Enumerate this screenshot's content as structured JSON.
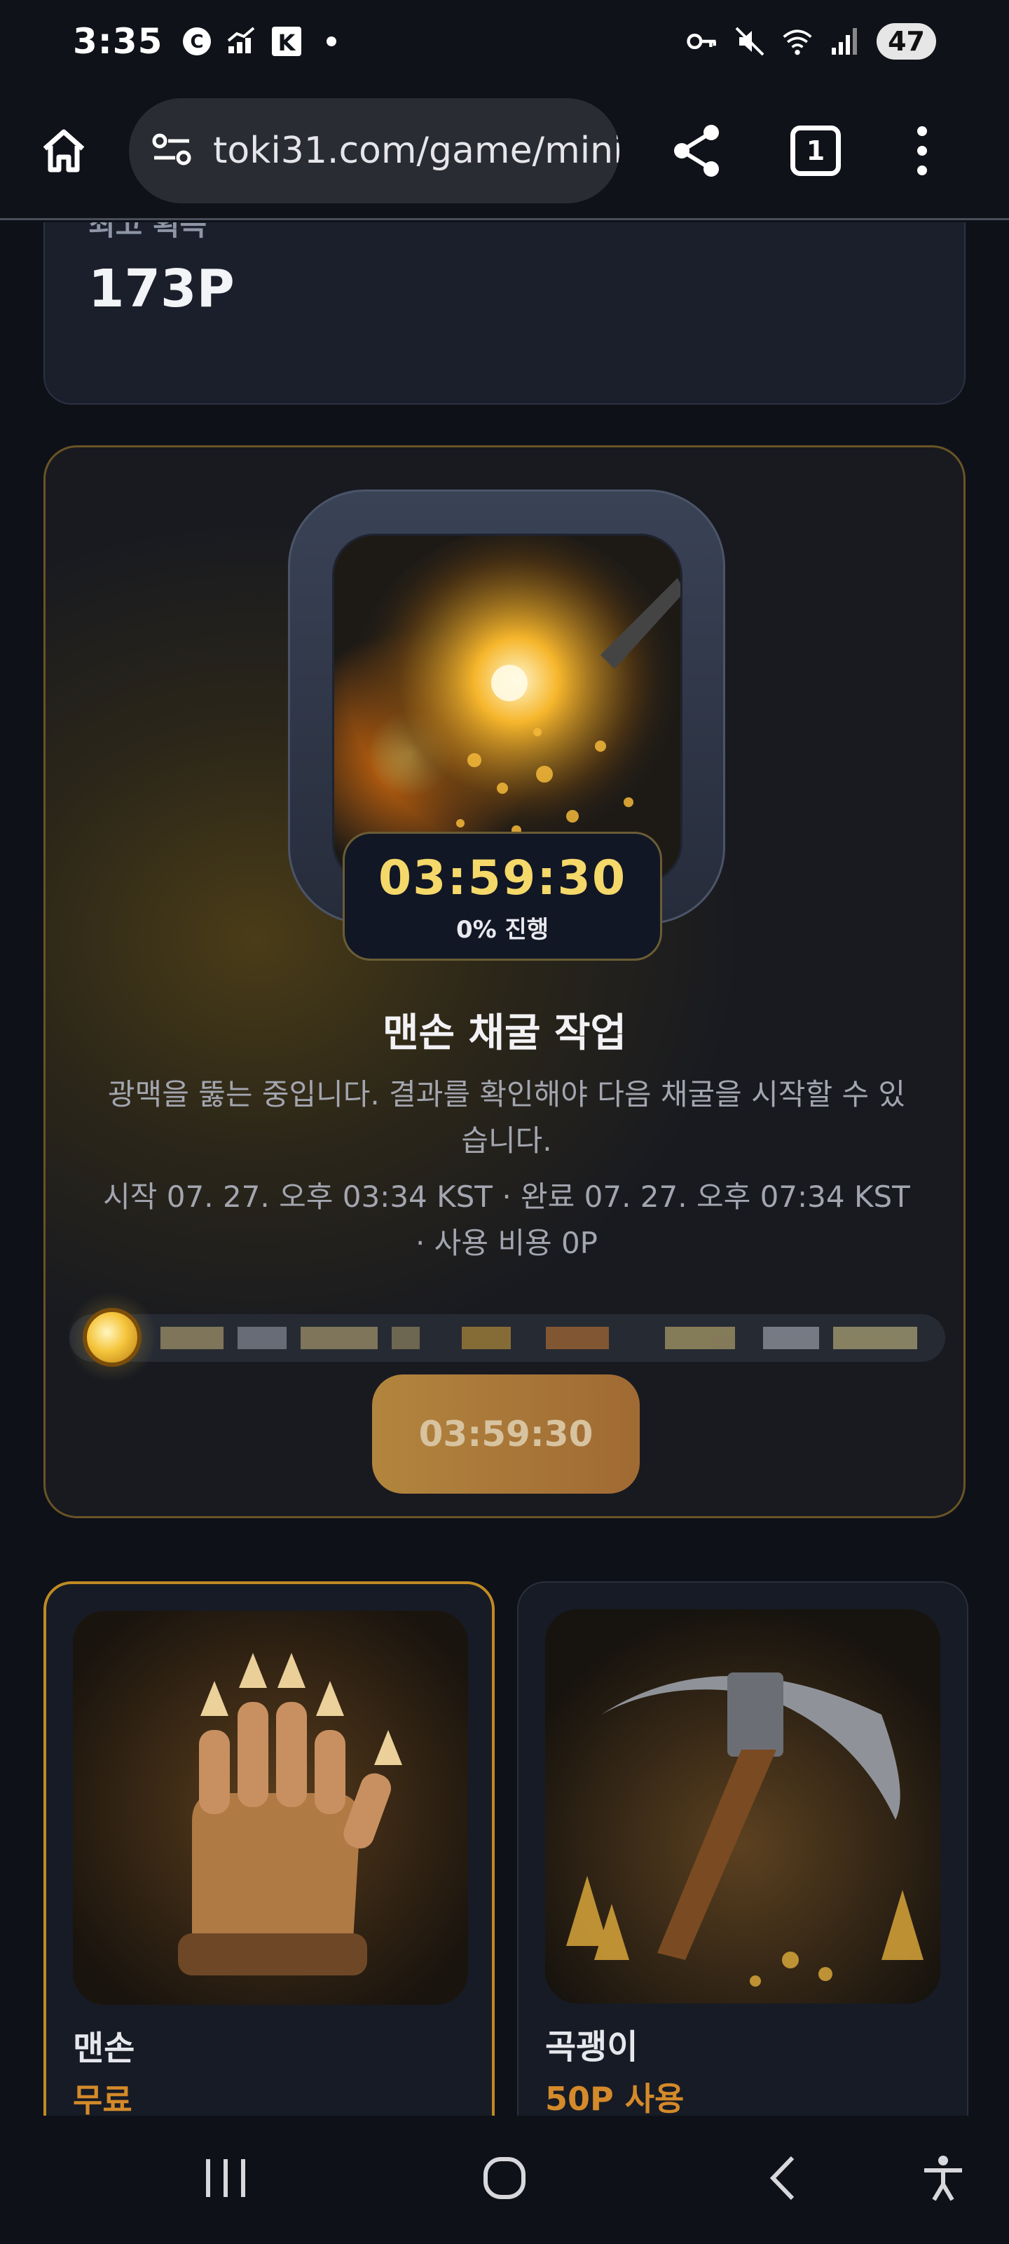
{
  "status_bar": {
    "time": "3:35",
    "battery": "47"
  },
  "browser": {
    "url": "toki31.com/game/minin",
    "tab_count": "1"
  },
  "best_gain": {
    "label": "최고 획득",
    "value": "173P"
  },
  "mining": {
    "timer": "03:59:30",
    "progress_text": "0% 진행",
    "progress_fraction": 0,
    "title": "맨손 채굴 작업",
    "description": "광맥을 뚫는 중입니다. 결과를 확인해야 다음 채굴을 시작할 수 있습니다.",
    "meta": "시작 07. 27. 오후 03:34 KST · 완료 07. 27. 오후 07:34 KST · 사용 비용 0P",
    "button_label": "03:59:30"
  },
  "tools": [
    {
      "name": "맨손",
      "cost": "무료"
    },
    {
      "name": "곡괭이",
      "cost": "50P 사용"
    }
  ],
  "colors": {
    "accent_gold": "#f5d86a",
    "cost_orange": "#d48a2a",
    "card_border": "#6a5424"
  }
}
